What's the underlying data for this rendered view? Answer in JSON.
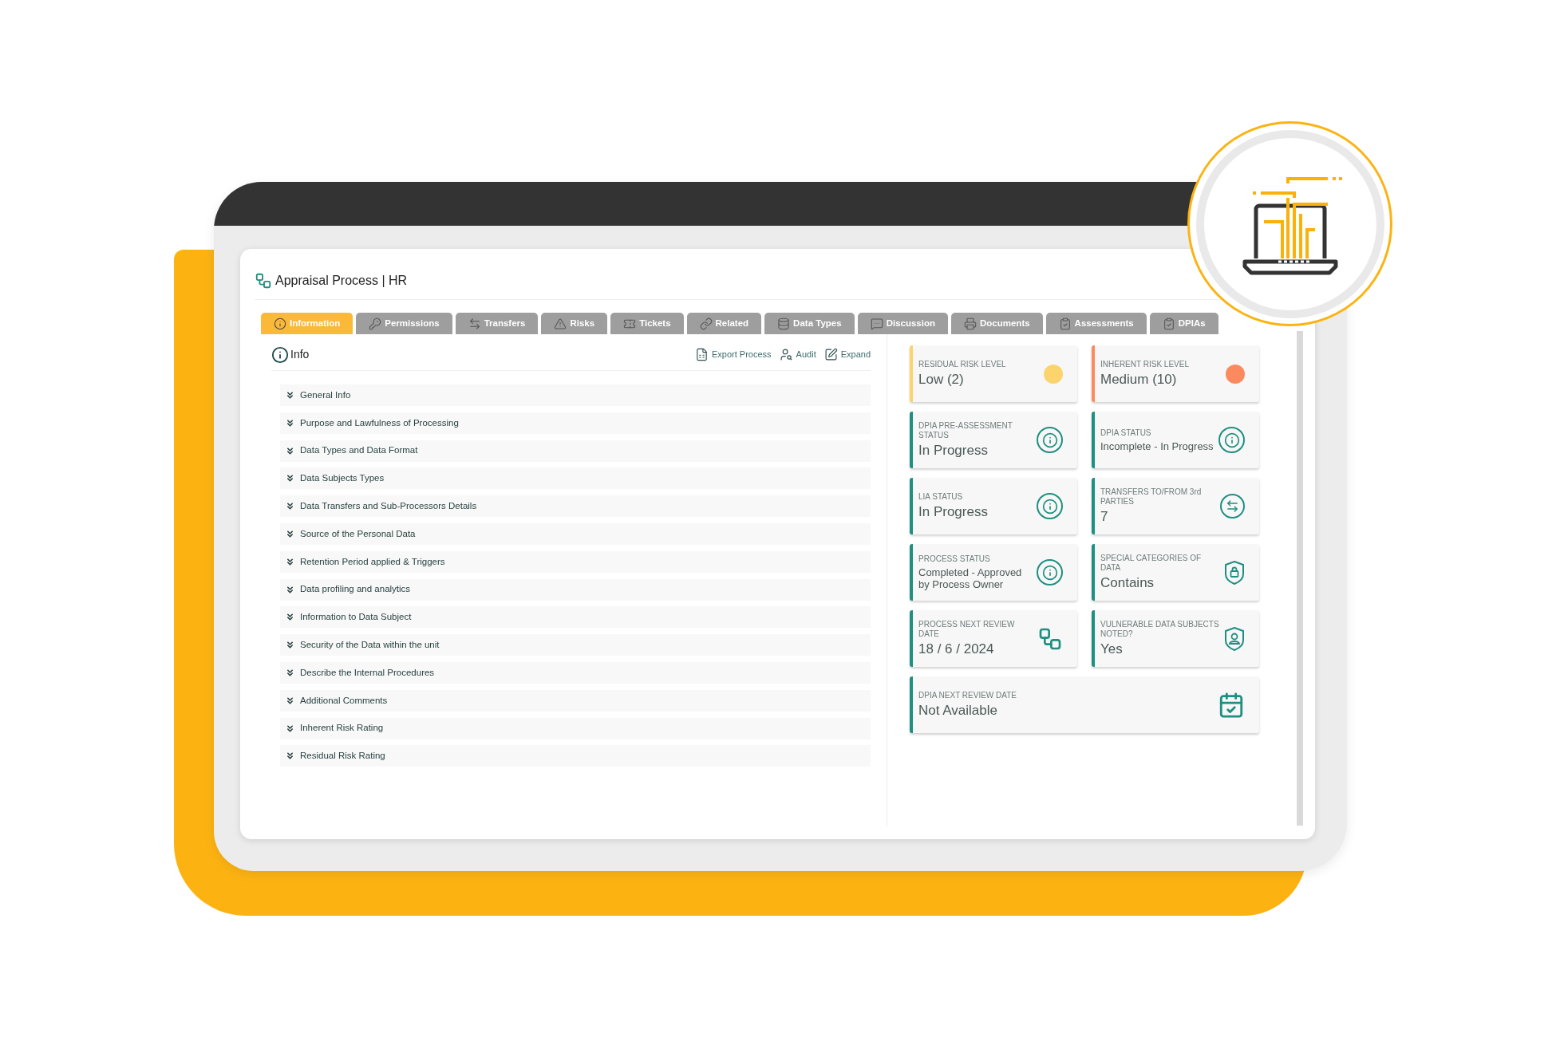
{
  "header": {
    "title": "Appraisal Process | HR"
  },
  "tabs": [
    {
      "label": "Information",
      "selected": true
    },
    {
      "label": "Permissions",
      "selected": false
    },
    {
      "label": "Transfers",
      "selected": false
    },
    {
      "label": "Risks",
      "selected": false
    },
    {
      "label": "Tickets",
      "selected": false
    },
    {
      "label": "Related",
      "selected": false
    },
    {
      "label": "Data Types",
      "selected": false
    },
    {
      "label": "Discussion",
      "selected": false
    },
    {
      "label": "Documents",
      "selected": false
    },
    {
      "label": "Assessments",
      "selected": false
    },
    {
      "label": "DPIAs",
      "selected": false
    }
  ],
  "info_panel": {
    "title": "Info",
    "actions": [
      "Export Process",
      "Audit",
      "Expand"
    ],
    "sections": [
      "General Info",
      "Purpose and Lawfulness of Processing",
      "Data Types and Data Format",
      "Data Subjects Types",
      "Data Transfers and Sub-Processors Details",
      "Source of the Personal Data",
      "Retention Period applied & Triggers",
      "Data profiling and analytics",
      "Information to Data Subject",
      "Security of the Data within the unit",
      "Describe the Internal Procedures",
      "Additional Comments",
      "Inherent Risk Rating",
      "Residual Risk Rating"
    ]
  },
  "cards": [
    {
      "label": "RESIDUAL RISK LEVEL",
      "value": "Low (2)",
      "kind": "risk",
      "color": "#fbd46e"
    },
    {
      "label": "INHERENT RISK LEVEL",
      "value": "Medium (10)",
      "kind": "risk",
      "color": "#fb8a5e"
    },
    {
      "label": "DPIA PRE-ASSESSMENT STATUS",
      "value": "In Progress",
      "kind": "info",
      "color": "#1e8f80"
    },
    {
      "label": "DPIA STATUS",
      "value": "Incomplete - In Progress",
      "kind": "info",
      "color": "#1e8f80"
    },
    {
      "label": "LIA STATUS",
      "value": "In Progress",
      "kind": "info",
      "color": "#1e8f80"
    },
    {
      "label": "TRANSFERS TO/FROM 3rd PARTIES",
      "value": "7",
      "kind": "transfers",
      "color": "#1e8f80"
    },
    {
      "label": "PROCESS STATUS",
      "value": "Completed - Approved by Process Owner",
      "kind": "info",
      "color": "#1e8f80"
    },
    {
      "label": "SPECIAL CATEGORIES OF DATA",
      "value": "Contains",
      "kind": "lock",
      "color": "#1e8f80"
    },
    {
      "label": "PROCESS NEXT REVIEW DATE",
      "value": "18 / 6 / 2024",
      "kind": "flow",
      "color": "#1e8f80"
    },
    {
      "label": "VULNERABLE DATA SUBJECTS NOTED?",
      "value": "Yes",
      "kind": "person",
      "color": "#1e8f80"
    },
    {
      "label": "DPIA NEXT REVIEW DATE",
      "value": "Not Available",
      "kind": "calendar",
      "color": "#1e8f80"
    }
  ]
}
